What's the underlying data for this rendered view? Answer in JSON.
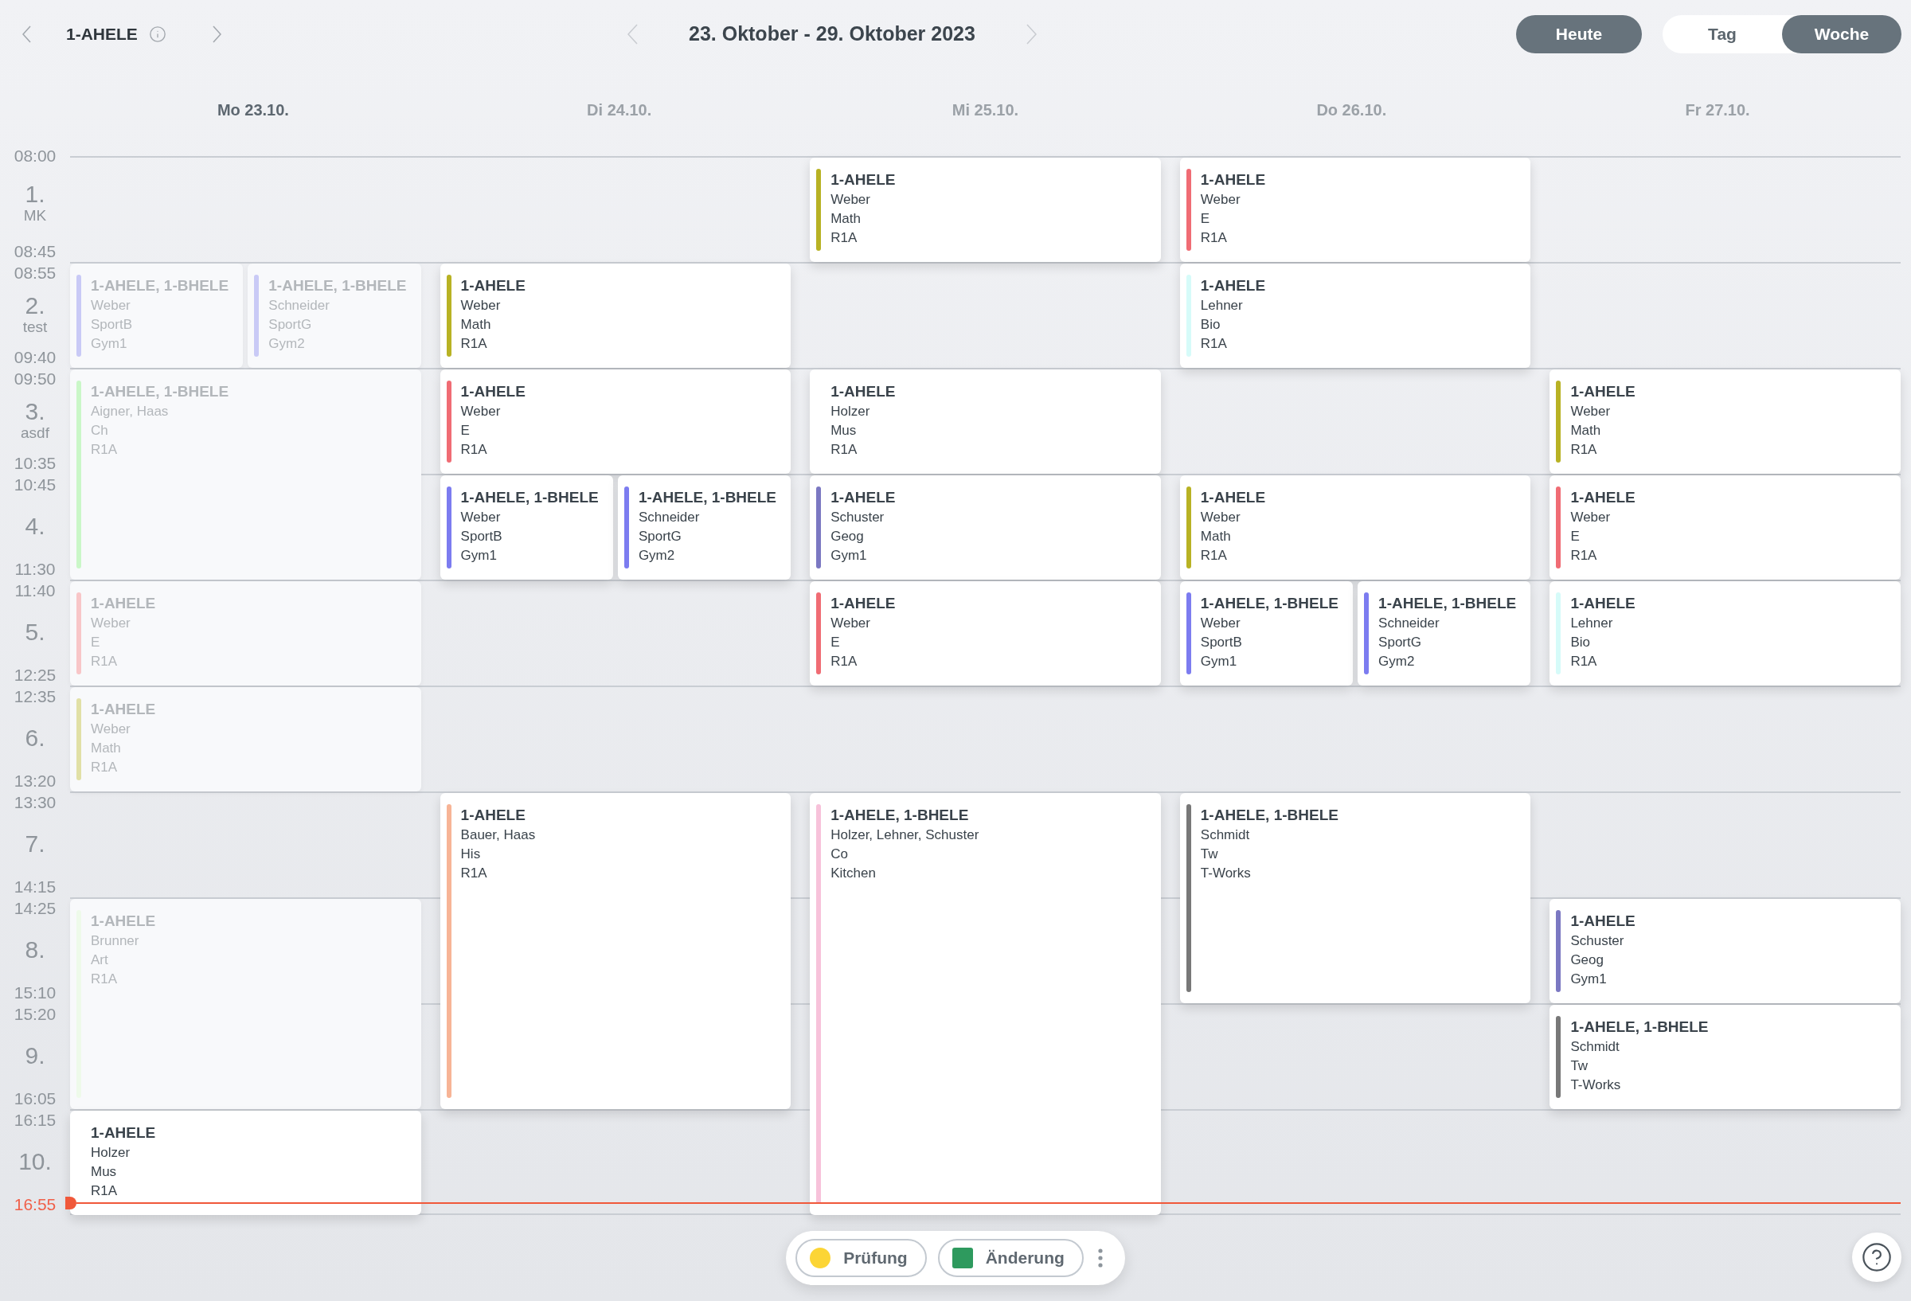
{
  "header": {
    "class_name": "1-AHELE",
    "date_range": "23. Oktober - 29. Oktober 2023",
    "today_button": "Heute",
    "view_tabs": [
      {
        "label": "Tag",
        "selected": false
      },
      {
        "label": "Woche",
        "selected": true
      }
    ]
  },
  "periods": [
    {
      "start": "08:00",
      "number": "1.",
      "note": "MK",
      "end": "08:45"
    },
    {
      "start": "08:55",
      "number": "2.",
      "note": "test",
      "end": "09:40"
    },
    {
      "start": "09:50",
      "number": "3.",
      "note": "asdf",
      "end": "10:35"
    },
    {
      "start": "10:45",
      "number": "4.",
      "end": "11:30"
    },
    {
      "start": "11:40",
      "number": "5.",
      "end": "12:25"
    },
    {
      "start": "12:35",
      "number": "6.",
      "end": "13:20"
    },
    {
      "start": "13:30",
      "number": "7.",
      "end": "14:15"
    },
    {
      "start": "14:25",
      "number": "8.",
      "end": "15:10"
    },
    {
      "start": "15:20",
      "number": "9.",
      "end": "16:05"
    },
    {
      "start": "16:15",
      "number": "10.",
      "now": "16:55"
    }
  ],
  "days": [
    {
      "label": "Mo 23.10.",
      "today": true,
      "slots": [
        {
          "kind": "free"
        },
        {
          "kind": "lesson",
          "lessons": [
            {
              "classes": "1-AHELE, 1-BHELE",
              "teacher": "Weber",
              "subject": "SportB",
              "room": "Gym1",
              "color": "#c9caf6",
              "past": true
            },
            {
              "classes": "1-AHELE, 1-BHELE",
              "teacher": "Schneider",
              "subject": "SportG",
              "room": "Gym2",
              "color": "#c9caf6",
              "past": true
            }
          ]
        },
        {
          "kind": "lesson",
          "lessons": [
            {
              "classes": "1-AHELE, 1-BHELE",
              "teacher": "Aigner, Haas",
              "subject": "Ch",
              "room": "R1A",
              "color": "#caf7c8",
              "past": true
            }
          ]
        },
        {
          "kind": "continued"
        },
        {
          "kind": "lesson",
          "lessons": [
            {
              "classes": "1-AHELE",
              "teacher": "Weber",
              "subject": "E",
              "room": "R1A",
              "color": "#f8c6c8",
              "past": true
            }
          ]
        },
        {
          "kind": "lesson",
          "lessons": [
            {
              "classes": "1-AHELE",
              "teacher": "Weber",
              "subject": "Math",
              "room": "R1A",
              "color": "#e1e0a6",
              "past": true
            }
          ]
        },
        {
          "kind": "free"
        },
        {
          "kind": "lesson",
          "lessons": [
            {
              "classes": "1-AHELE",
              "teacher": "Brunner",
              "subject": "Art",
              "room": "R1A",
              "color": "#eefaea",
              "past": true
            }
          ]
        },
        {
          "kind": "continued"
        },
        {
          "kind": "lesson",
          "lessons": [
            {
              "classes": "1-AHELE",
              "teacher": "Holzer",
              "subject": "Mus",
              "room": "R1A",
              "past": false
            }
          ]
        }
      ]
    },
    {
      "label": "Di 24.10.",
      "today": false,
      "slots": [
        {
          "kind": "free"
        },
        {
          "kind": "lesson",
          "lessons": [
            {
              "classes": "1-AHELE",
              "teacher": "Weber",
              "subject": "Math",
              "room": "R1A",
              "color": "#b8b224",
              "past": false
            }
          ]
        },
        {
          "kind": "lesson",
          "lessons": [
            {
              "classes": "1-AHELE",
              "teacher": "Weber",
              "subject": "E",
              "room": "R1A",
              "color": "#f06c74",
              "past": false
            }
          ]
        },
        {
          "kind": "lesson",
          "lessons": [
            {
              "classes": "1-AHELE, 1-BHELE",
              "teacher": "Weber",
              "subject": "SportB",
              "room": "Gym1",
              "color": "#7c7cf0",
              "past": false
            },
            {
              "classes": "1-AHELE, 1-BHELE",
              "teacher": "Schneider",
              "subject": "SportG",
              "room": "Gym2",
              "color": "#7c7cf0",
              "past": false
            }
          ]
        },
        {
          "kind": "free"
        },
        {
          "kind": "free"
        },
        {
          "kind": "lesson",
          "lessons": [
            {
              "classes": "1-AHELE",
              "teacher": "Bauer, Haas",
              "subject": "His",
              "room": "R1A",
              "color": "#f7b496",
              "past": false
            }
          ]
        },
        {
          "kind": "continued"
        },
        {
          "kind": "continued"
        },
        {
          "kind": "free"
        }
      ]
    },
    {
      "label": "Mi 25.10.",
      "today": false,
      "slots": [
        {
          "kind": "lesson",
          "lessons": [
            {
              "classes": "1-AHELE",
              "teacher": "Weber",
              "subject": "Math",
              "room": "R1A",
              "color": "#b8b224",
              "past": false
            }
          ]
        },
        {
          "kind": "free"
        },
        {
          "kind": "lesson",
          "lessons": [
            {
              "classes": "1-AHELE",
              "teacher": "Holzer",
              "subject": "Mus",
              "room": "R1A",
              "past": false
            }
          ]
        },
        {
          "kind": "lesson",
          "lessons": [
            {
              "classes": "1-AHELE",
              "teacher": "Schuster",
              "subject": "Geog",
              "room": "Gym1",
              "color": "#7b78c2",
              "past": false
            }
          ]
        },
        {
          "kind": "lesson",
          "lessons": [
            {
              "classes": "1-AHELE",
              "teacher": "Weber",
              "subject": "E",
              "room": "R1A",
              "color": "#f06c74",
              "past": false
            }
          ]
        },
        {
          "kind": "free"
        },
        {
          "kind": "lesson",
          "lessons": [
            {
              "classes": "1-AHELE, 1-BHELE",
              "teacher": "Holzer, Lehner, Schuster",
              "subject": "Co",
              "room": "Kitchen",
              "color": "#f7c2da",
              "past": false
            }
          ]
        },
        {
          "kind": "continued"
        },
        {
          "kind": "continued"
        },
        {
          "kind": "continued"
        }
      ]
    },
    {
      "label": "Do 26.10.",
      "today": false,
      "slots": [
        {
          "kind": "lesson",
          "lessons": [
            {
              "classes": "1-AHELE",
              "teacher": "Weber",
              "subject": "E",
              "room": "R1A",
              "color": "#f06c74",
              "past": false
            }
          ]
        },
        {
          "kind": "lesson",
          "lessons": [
            {
              "classes": "1-AHELE",
              "teacher": "Lehner",
              "subject": "Bio",
              "room": "R1A",
              "color": "#d6fbf9",
              "past": false
            }
          ]
        },
        {
          "kind": "free"
        },
        {
          "kind": "lesson",
          "lessons": [
            {
              "classes": "1-AHELE",
              "teacher": "Weber",
              "subject": "Math",
              "room": "R1A",
              "color": "#b8b224",
              "past": false
            }
          ]
        },
        {
          "kind": "lesson",
          "lessons": [
            {
              "classes": "1-AHELE, 1-BHELE",
              "teacher": "Weber",
              "subject": "SportB",
              "room": "Gym1",
              "color": "#7c7cf0",
              "past": false
            },
            {
              "classes": "1-AHELE, 1-BHELE",
              "teacher": "Schneider",
              "subject": "SportG",
              "room": "Gym2",
              "color": "#7c7cf0",
              "past": false
            }
          ]
        },
        {
          "kind": "free"
        },
        {
          "kind": "lesson",
          "lessons": [
            {
              "classes": "1-AHELE, 1-BHELE",
              "teacher": "Schmidt",
              "subject": "Tw",
              "room": "T-Works",
              "color": "#787878",
              "past": false
            }
          ]
        },
        {
          "kind": "continued"
        },
        {
          "kind": "free"
        },
        {
          "kind": "free"
        }
      ]
    },
    {
      "label": "Fr 27.10.",
      "today": false,
      "slots": [
        {
          "kind": "free"
        },
        {
          "kind": "free"
        },
        {
          "kind": "lesson",
          "lessons": [
            {
              "classes": "1-AHELE",
              "teacher": "Weber",
              "subject": "Math",
              "room": "R1A",
              "color": "#b8b224",
              "past": false
            }
          ]
        },
        {
          "kind": "lesson",
          "lessons": [
            {
              "classes": "1-AHELE",
              "teacher": "Weber",
              "subject": "E",
              "room": "R1A",
              "color": "#f06c74",
              "past": false
            }
          ]
        },
        {
          "kind": "lesson",
          "lessons": [
            {
              "classes": "1-AHELE",
              "teacher": "Lehner",
              "subject": "Bio",
              "room": "R1A",
              "color": "#d6fbf9",
              "past": false
            }
          ]
        },
        {
          "kind": "free"
        },
        {
          "kind": "free"
        },
        {
          "kind": "lesson",
          "lessons": [
            {
              "classes": "1-AHELE",
              "teacher": "Schuster",
              "subject": "Geog",
              "room": "Gym1",
              "color": "#7b78c2",
              "past": false
            }
          ]
        },
        {
          "kind": "lesson",
          "lessons": [
            {
              "classes": "1-AHELE, 1-BHELE",
              "teacher": "Schmidt",
              "subject": "Tw",
              "room": "T-Works",
              "color": "#787878",
              "past": false
            }
          ]
        },
        {
          "kind": "free"
        }
      ]
    }
  ],
  "legend": [
    {
      "label": "Prüfung",
      "kind": "circle",
      "color": "#fcd535"
    },
    {
      "label": "Änderung",
      "kind": "square",
      "color": "#2e9a5e"
    }
  ]
}
